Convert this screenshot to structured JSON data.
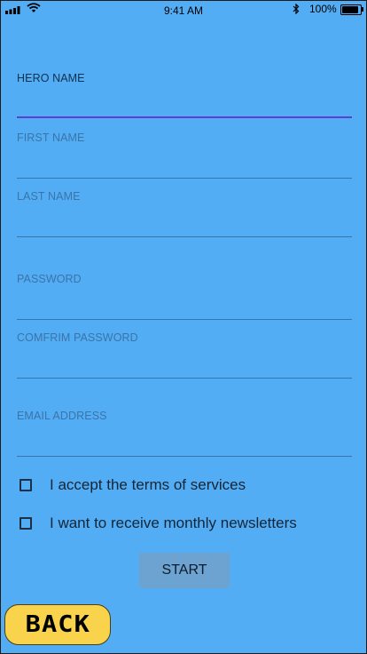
{
  "status_bar": {
    "time": "9:41 AM",
    "battery_percent": "100%",
    "battery_level": 1.0,
    "icons": [
      "signal-icon",
      "wifi-icon",
      "bluetooth-icon",
      "battery-icon"
    ]
  },
  "form": {
    "fields": [
      {
        "label": "HERO NAME",
        "value": "",
        "focused": true
      },
      {
        "label": "FIRST NAME",
        "value": ""
      },
      {
        "label": "LAST NAME",
        "value": ""
      },
      {
        "label": "PASSWORD",
        "value": ""
      },
      {
        "label": "COMFRIM PASSWORD",
        "value": ""
      },
      {
        "label": "EMAIL ADDRESS",
        "value": ""
      }
    ],
    "checkboxes": [
      {
        "label": "I accept the terms of services",
        "checked": false
      },
      {
        "label": "I want to receive monthly newsletters",
        "checked": false
      }
    ],
    "start_label": "START"
  },
  "back_label": "BACK",
  "colors": {
    "background": "#52adf4",
    "focus_underline": "#5d3fd3",
    "start_button": "#6da3d1",
    "back_button": "#f9d34c"
  }
}
